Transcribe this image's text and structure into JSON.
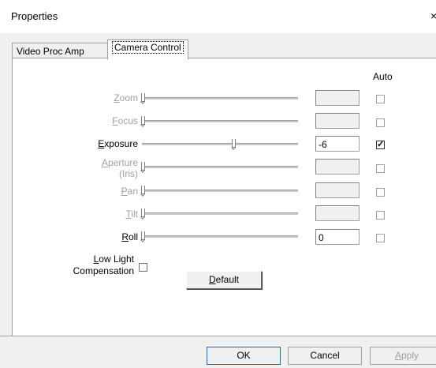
{
  "window": {
    "title": "Properties",
    "close_glyph": "×"
  },
  "tabs": [
    {
      "label": "Video Proc Amp",
      "active": false
    },
    {
      "label": "Camera Control",
      "active": true
    }
  ],
  "auto_header": "Auto",
  "rows": [
    {
      "label": "Zoom",
      "mnemonic": "Z",
      "rest": "oom",
      "enabled": false,
      "value": "",
      "auto": false,
      "level": 0.0
    },
    {
      "label": "Focus",
      "mnemonic": "F",
      "rest": "ocus",
      "enabled": false,
      "value": "",
      "auto": false,
      "level": 0.0
    },
    {
      "label": "Exposure",
      "mnemonic": "E",
      "rest": "xposure",
      "enabled": true,
      "value": "-6",
      "auto": true,
      "level": 0.58
    },
    {
      "label": "Aperture (Iris)",
      "mnemonic": "A",
      "rest": "perture",
      "line2": "(Iris)",
      "enabled": false,
      "value": "",
      "auto": false,
      "level": 0.0
    },
    {
      "label": "Pan",
      "mnemonic": "P",
      "rest": "an",
      "enabled": false,
      "value": "",
      "auto": false,
      "level": 0.0
    },
    {
      "label": "Tilt",
      "mnemonic": "T",
      "rest": "ilt",
      "enabled": false,
      "value": "",
      "auto": false,
      "level": 0.0
    },
    {
      "label": "Roll",
      "mnemonic": "R",
      "rest": "oll",
      "enabled": true,
      "value": "0",
      "auto": false,
      "level": 0.0
    }
  ],
  "low_light": {
    "line1": "Low Light",
    "mnemonic": "L",
    "rest1": "ow Light",
    "line2": "Compensation",
    "checked": false
  },
  "buttons": {
    "default": {
      "mnemonic": "D",
      "rest": "efault"
    },
    "ok": "OK",
    "cancel": "Cancel",
    "apply": {
      "mnemonic": "A",
      "rest": "pply"
    }
  },
  "colors": {
    "disabled_text": "#a0a0a0",
    "dialog_bg": "#f0f0f0",
    "panel_bg": "#ffffff"
  }
}
